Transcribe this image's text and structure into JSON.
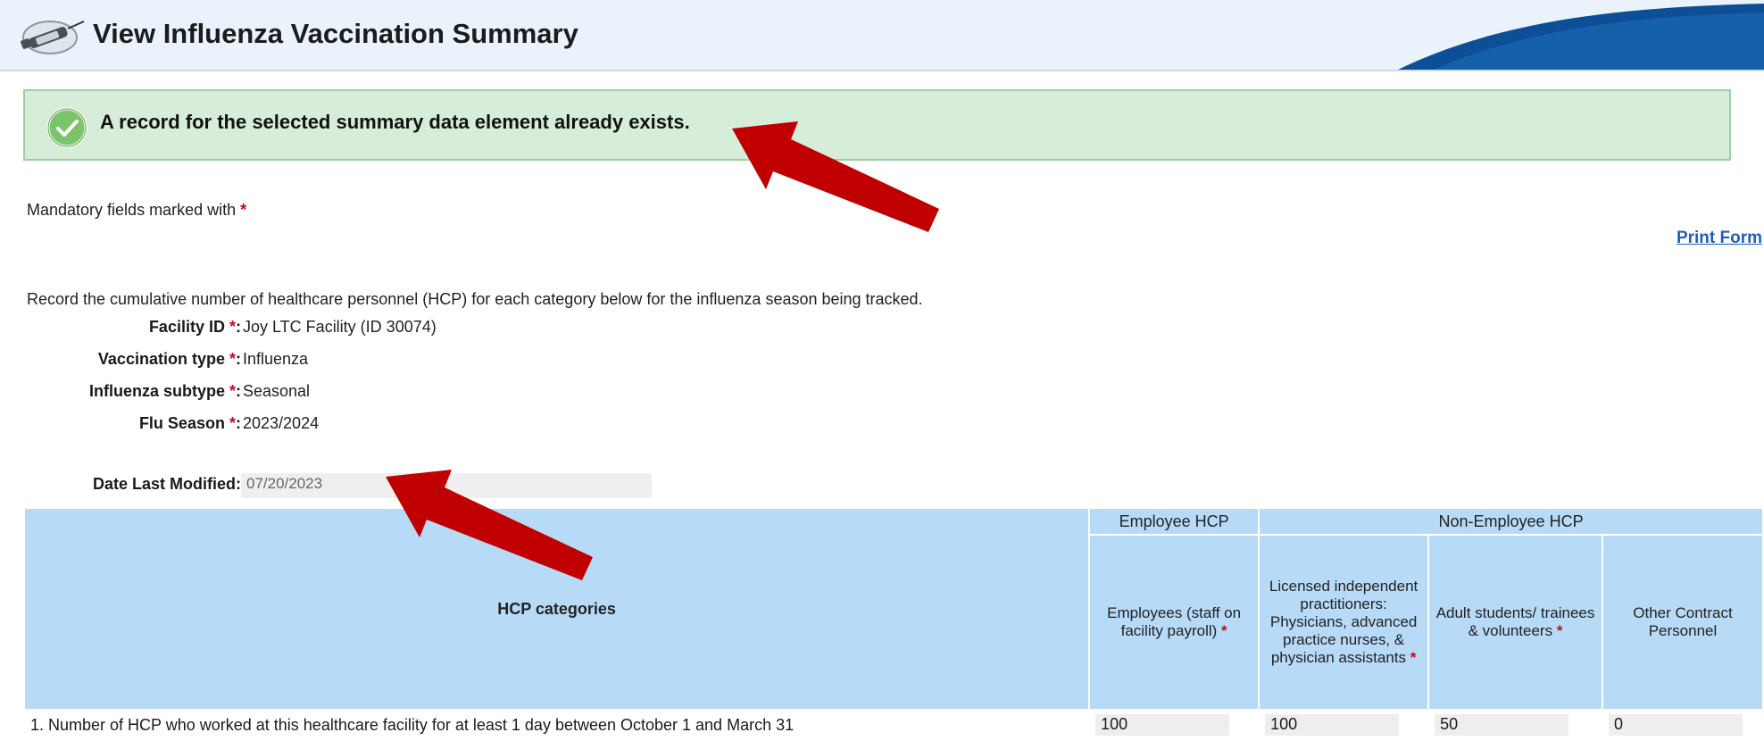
{
  "header": {
    "title": "View Influenza Vaccination Summary",
    "icon": "syringe-icon"
  },
  "alert": {
    "message": "A record for the selected summary data element already exists.",
    "icon": "check-circle-icon",
    "color": "#d6edd9"
  },
  "mandatory_note": "Mandatory fields marked with",
  "required_marker": "*",
  "print_link": "Print Form",
  "instructions": "Record the cumulative number of healthcare personnel (HCP) for each category below for the influenza season being tracked.",
  "fields": [
    {
      "label": "Facility ID",
      "value": "Joy LTC Facility (ID 30074)"
    },
    {
      "label": "Vaccination type",
      "value": "Influenza"
    },
    {
      "label": "Influenza subtype",
      "value": "Seasonal"
    },
    {
      "label": "Flu Season",
      "value": "2023/2024"
    }
  ],
  "date_modified": {
    "label": "Date Last Modified:",
    "value": "07/20/2023"
  },
  "table": {
    "category_header": "HCP categories",
    "group_employee": "Employee HCP",
    "group_non_employee": "Non-Employee HCP",
    "col_employees": "Employees (staff on facility payroll)",
    "col_licensed": "Licensed independent practitioners: Physicians, advanced practice nurses, & physician assistants",
    "col_students": "Adult students/ trainees & volunteers",
    "col_other": "Other Contract Personnel",
    "rows": [
      {
        "label": "1. Number of HCP who worked at this healthcare facility for at least 1 day between October 1 and March 31",
        "employees": "100",
        "licensed": "100",
        "students": "50",
        "other": "0"
      }
    ]
  },
  "colors": {
    "header_bg": "#eaf3fb",
    "table_header_bg": "#b7dbf7",
    "arrow": "#c00000",
    "link": "#1f5fb5",
    "required": "#d0021b"
  }
}
